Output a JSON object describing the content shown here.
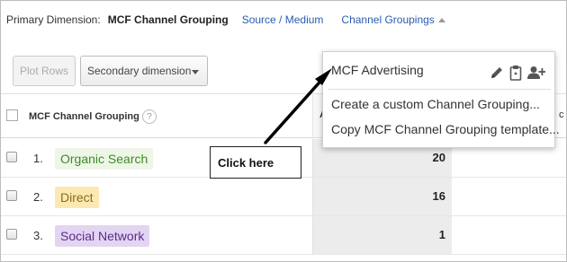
{
  "dimension_bar": {
    "label": "Primary Dimension:",
    "active": "MCF Channel Grouping",
    "link_source_medium": "Source / Medium",
    "link_channel_groupings": "Channel Groupings"
  },
  "toolbar": {
    "plot_rows": "Plot Rows",
    "secondary_dimension": "Secondary dimension"
  },
  "table": {
    "column_header": "MCF Channel Grouping",
    "help": "?",
    "metric_header_fragment": "A",
    "right_header_fragment": "c",
    "rows": [
      {
        "index": "1.",
        "label": "Organic Search",
        "value": "20"
      },
      {
        "index": "2.",
        "label": "Direct",
        "value": "16"
      },
      {
        "index": "3.",
        "label": "Social Network",
        "value": "1"
      }
    ]
  },
  "menu": {
    "header": "MCF Advertising",
    "items": [
      "Create a custom Channel Grouping...",
      "Copy MCF Channel Grouping template..."
    ],
    "icons": [
      "pencil-icon",
      "clipboard-icon",
      "add-user-icon"
    ]
  },
  "annotation": {
    "callout": "Click here"
  },
  "colors": {
    "link": "#2a5db0",
    "organic_search_bg": "#eef6e8",
    "organic_search_text": "#3d8c25",
    "direct_bg": "#fce9b2",
    "social_network_bg": "#e3d5f1",
    "social_network_text": "#5b2b8f"
  }
}
